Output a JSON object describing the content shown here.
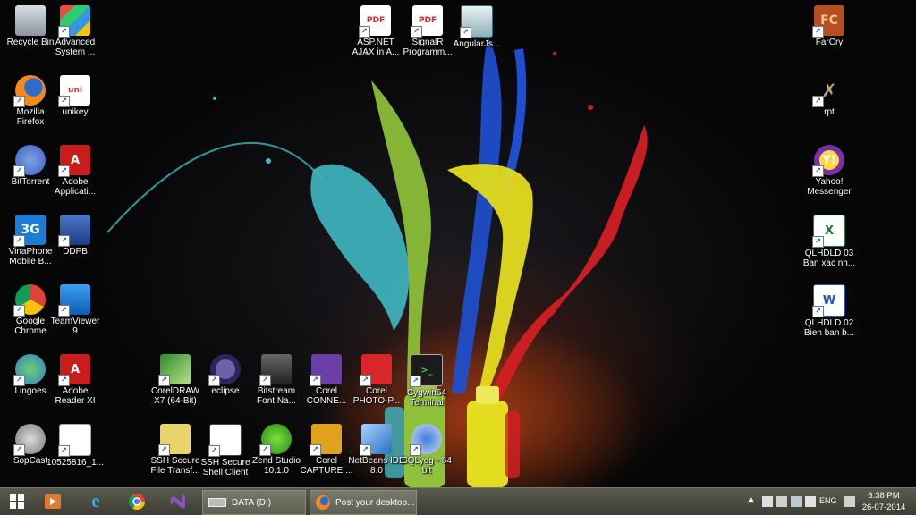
{
  "colors": {
    "taskbar": "#4a4a40",
    "accent": "#ffffff"
  },
  "desktop": {
    "icons": [
      {
        "id": "recycle",
        "label": "Recycle Bin",
        "icon": "recycle-bin-icon"
      },
      {
        "id": "advsys",
        "label": "Advanced\nSystem ...",
        "icon": "shield-icon"
      },
      {
        "id": "aspnet",
        "label": "ASP.NET\nAJAX in A...",
        "icon": "pdf-icon"
      },
      {
        "id": "signalr",
        "label": "SignalR\nProgramm...",
        "icon": "pdf-icon"
      },
      {
        "id": "angularjs",
        "label": "AngularJs...",
        "icon": "app-icon"
      },
      {
        "id": "farcry",
        "label": "FarCry",
        "icon": "farcry-icon"
      },
      {
        "id": "firefox",
        "label": "Mozilla\nFirefox",
        "icon": "firefox-icon"
      },
      {
        "id": "unikey",
        "label": "unikey",
        "icon": "unikey-icon"
      },
      {
        "id": "rpt",
        "label": "rpt",
        "icon": "rpt-icon"
      },
      {
        "id": "bittorrent",
        "label": "BitTorrent",
        "icon": "bittorrent-icon"
      },
      {
        "id": "adobeapp",
        "label": "Adobe\nApplicati...",
        "icon": "adobe-icon"
      },
      {
        "id": "yahoo",
        "label": "Yahoo!\nMessenger",
        "icon": "yahoo-icon"
      },
      {
        "id": "vinaphone",
        "label": "VinaPhone\nMobile B...",
        "icon": "3g-icon"
      },
      {
        "id": "ddpb",
        "label": "DDPB",
        "icon": "ddpb-icon"
      },
      {
        "id": "qlhdld03",
        "label": "QLHDLD 03\nBan xac nh...",
        "icon": "excel-icon"
      },
      {
        "id": "chrome",
        "label": "Google\nChrome",
        "icon": "chrome-icon"
      },
      {
        "id": "teamviewer",
        "label": "TeamViewer\n9",
        "icon": "teamviewer-icon"
      },
      {
        "id": "qlhdld02",
        "label": "QLHDLD 02\nBien ban b...",
        "icon": "word-icon"
      },
      {
        "id": "lingoes",
        "label": "Lingoes",
        "icon": "lingoes-icon"
      },
      {
        "id": "adobereader",
        "label": "Adobe\nReader XI",
        "icon": "adobe-reader-icon"
      },
      {
        "id": "coreldraw",
        "label": "CorelDRAW\nX7 (64-Bit)",
        "icon": "coreldraw-icon"
      },
      {
        "id": "eclipse",
        "label": "eclipse",
        "icon": "eclipse-icon"
      },
      {
        "id": "bitstream",
        "label": "Bitstream\nFont Na...",
        "icon": "bitstream-icon"
      },
      {
        "id": "corelconnect",
        "label": "Corel\nCONNE...",
        "icon": "corel-connect-icon"
      },
      {
        "id": "corelphoto",
        "label": "Corel\nPHOTO-P...",
        "icon": "corel-photo-icon"
      },
      {
        "id": "cygwin",
        "label": "Cygwin64\nTerminal",
        "icon": "terminal-icon"
      },
      {
        "id": "sopcast",
        "label": "SopCast",
        "icon": "sopcast-icon"
      },
      {
        "id": "file1052",
        "label": "10525816_1...",
        "icon": "document-icon"
      },
      {
        "id": "sshfile",
        "label": "SSH Secure\nFile Transf...",
        "icon": "ssh-file-icon"
      },
      {
        "id": "sshshell",
        "label": "SSH Secure\nShell Client",
        "icon": "ssh-shell-icon"
      },
      {
        "id": "zend",
        "label": "Zend Studio\n10.1.0",
        "icon": "zend-icon"
      },
      {
        "id": "corelcapture",
        "label": "Corel\nCAPTURE ...",
        "icon": "corel-capture-icon"
      },
      {
        "id": "netbeans",
        "label": "NetBeans IDE\n8.0",
        "icon": "netbeans-icon"
      },
      {
        "id": "sqlyog",
        "label": "SQLyog - 64\nbit",
        "icon": "sqlyog-icon"
      }
    ]
  },
  "taskbar": {
    "tasks": [
      {
        "label": "DATA (D:)",
        "icon": "drive-icon"
      },
      {
        "label": "Post your desktop...",
        "icon": "firefox-icon"
      }
    ],
    "tray": {
      "language": "ENG",
      "time": "6:38 PM",
      "date": "26-07-2014"
    }
  }
}
